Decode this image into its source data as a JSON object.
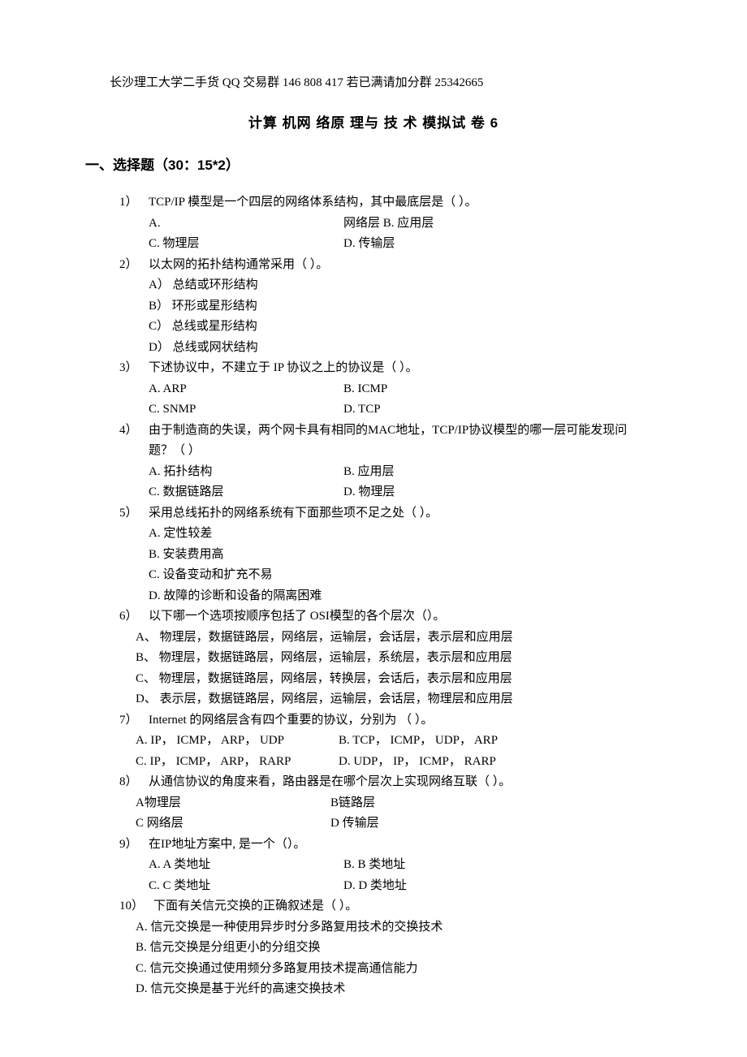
{
  "header": "长沙理工大学二手货 QQ 交易群 146 808 417 若已满请加分群 25342665",
  "title": "计算 机网 络原 理与 技 术 模拟试 卷 6",
  "sectionHeading": "一、选择题（30：15*2）",
  "questions": [
    {
      "num": "1）",
      "text": "TCP/IP 模型是一个四层的网络体系结构，其中最底层是（ ）。",
      "layout": "4col-special",
      "row1a": "A.",
      "row1b": "网络层 B. 应用层",
      "row2a": "C. 物理层",
      "row2b": "D. 传输层"
    },
    {
      "num": "2）",
      "text": "以太网的拓扑结构通常采用（ ）。",
      "layout": "1col",
      "opts": [
        "A） 总结或环形结构",
        "B） 环形或星形结构",
        "C） 总线或星形结构",
        "D） 总线或网状结构"
      ]
    },
    {
      "num": "3）",
      "text": "下述协议中，不建立于 IP 协议之上的协议是（ ）。",
      "layout": "2col",
      "row1a": "A.  ARP",
      "row1b": "B.  ICMP",
      "row2a": "C.  SNMP",
      "row2b": "D.  TCP"
    },
    {
      "num": "4）",
      "text": "由于制造商的失误，两个网卡具有相同的MAC地址，TCP/IP协议模型的哪一层可能发现问题？（ ）",
      "layout": "2col",
      "row1a": "A.  拓扑结构",
      "row1b": "B. 应用层",
      "row2a": "C. 数据链路层",
      "row2b": "D. 物理层"
    },
    {
      "num": "5）",
      "text": "采用总线拓扑的网络系统有下面那些项不足之处（ ）。",
      "layout": "1col",
      "opts": [
        "A.  定性较差",
        "B.  安装费用高",
        "C.  设备变动和扩充不易",
        "D.  故障的诊断和设备的隔离困难"
      ]
    },
    {
      "num": "6）",
      "text": "以下哪一个选项按顺序包括了 OSI模型的各个层次（）。",
      "layout": "1col-noindent",
      "opts": [
        "A、 物理层，数据链路层，网络层，运输层，会话层，表示层和应用层",
        "B、 物理层，数据链路层，网络层，运输层，系统层，表示层和应用层",
        "C、 物理层，数据链路层，网络层，转换层，会话后，表示层和应用层",
        "D、 表示层，数据链路层，网络层，运输层，会话层，物理层和应用层"
      ]
    },
    {
      "num": "7）",
      "text": "Internet 的网络层含有四个重要的协议，分别为 （ ）。",
      "layout": "2col-wide",
      "row1a": "A. IP， ICMP， ARP， UDP",
      "row1b": "B. TCP， ICMP， UDP， ARP",
      "row2a": "C. IP， ICMP， ARP， RARP",
      "row2b": "D. UDP， IP， ICMP， RARP"
    },
    {
      "num": "8）",
      "text": "从通信协议的角度来看，路由器是在哪个层次上实现网络互联（ ）。",
      "layout": "2col",
      "row1a": "A物理层",
      "row1b": "B链路层",
      "row2a": "C 网络层",
      "row2b": "D 传输层"
    },
    {
      "num": "9）",
      "text": "在IP地址方案中, 是一个（）。",
      "layout": "2col",
      "row1a": "A. A 类地址",
      "row1b": "B.  B 类地址",
      "row2a": "C. C 类地址",
      "row2b": "D.  D 类地址"
    },
    {
      "num": "10）",
      "text": "下面有关信元交换的正确叙述是（ ）。",
      "layout": "1col-noindent",
      "opts": [
        "A.  信元交换是一种使用异步时分多路复用技术的交换技术",
        "B.  信元交换是分组更小的分组交换",
        "C.  信元交换通过使用频分多路复用技术提高通信能力",
        "D.  信元交换是基于光纤的高速交换技术"
      ]
    }
  ]
}
